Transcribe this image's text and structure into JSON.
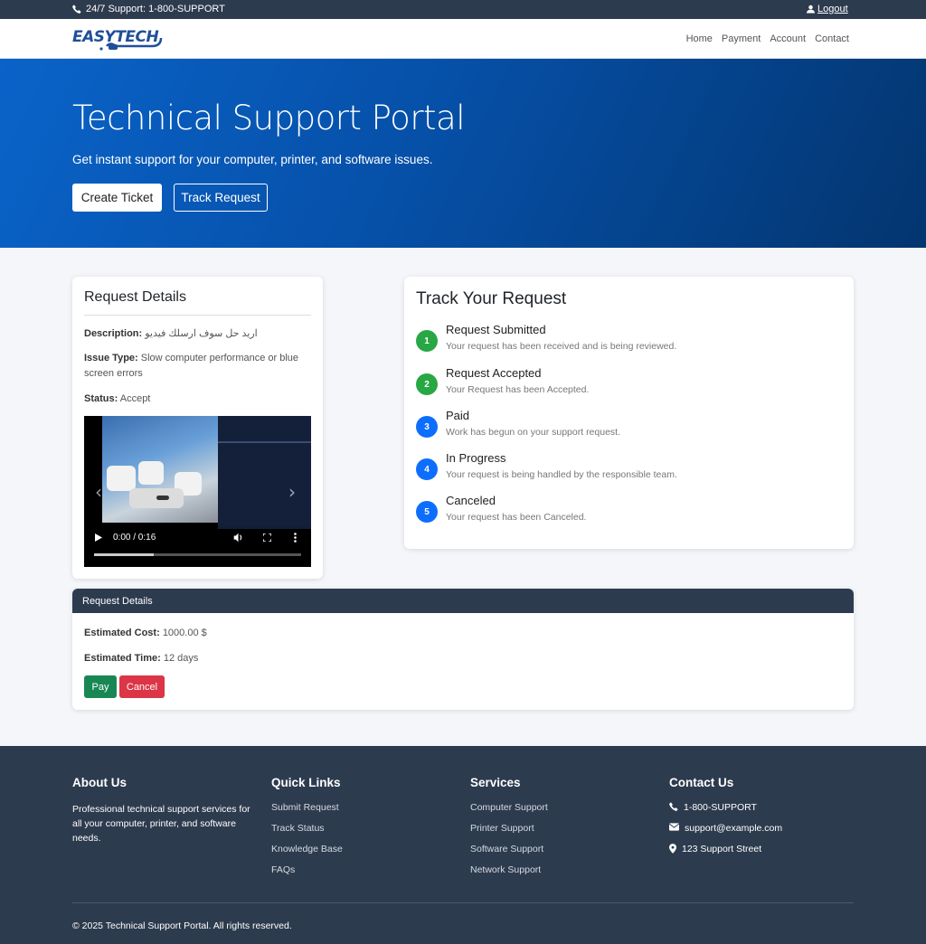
{
  "topbar": {
    "support": "24/7 Support: 1-800-SUPPORT",
    "logout": "Logout"
  },
  "brand": {
    "logo_text": "EASYTECH",
    "logo_color": "#1f4f9a"
  },
  "nav": [
    "Home",
    "Payment",
    "Account",
    "Contact"
  ],
  "hero": {
    "title": "Technical Support Portal",
    "subtitle": "Get instant support for your computer, printer, and software issues.",
    "create_ticket": "Create Ticket",
    "track_request": "Track Request"
  },
  "request": {
    "heading": "Request Details",
    "description_label": "Description:",
    "description": "اريد حل سوف ارسلك فيديو",
    "issue_label": "Issue Type:",
    "issue": "Slow computer performance or blue screen errors",
    "status_label": "Status:",
    "status": "Accept",
    "video_time": "0:00 / 0:16",
    "video_progress": 0.29
  },
  "track": {
    "heading": "Track Your Request",
    "steps": [
      {
        "num": "1",
        "title": "Request Submitted",
        "desc": "Your request has been received and is being reviewed.",
        "color": "#28a745"
      },
      {
        "num": "2",
        "title": "Request Accepted",
        "desc": "Your Request has been Accepted.",
        "color": "#28a745"
      },
      {
        "num": "3",
        "title": "Paid",
        "desc": "Work has begun on your support request.",
        "color": "#0d6efd"
      },
      {
        "num": "4",
        "title": "In Progress",
        "desc": "Your request is being handled by the responsible team.",
        "color": "#0d6efd"
      },
      {
        "num": "5",
        "title": "Canceled",
        "desc": "Your request has been Canceled.",
        "color": "#0d6efd"
      }
    ]
  },
  "estimate": {
    "heading": "Request Details",
    "cost_label": "Estimated Cost:",
    "cost": "1000.00 $",
    "time_label": "Estimated Time:",
    "time": "12 days",
    "pay": "Pay",
    "cancel": "Cancel"
  },
  "footer": {
    "about_title": "About Us",
    "about_text": "Professional technical support services for all your computer, printer, and software needs.",
    "quick_title": "Quick Links",
    "quick_links": [
      "Submit Request",
      "Track Status",
      "Knowledge Base",
      "FAQs"
    ],
    "services_title": "Services",
    "services": [
      "Computer Support",
      "Printer Support",
      "Software Support",
      "Network Support"
    ],
    "contact_title": "Contact Us",
    "phone": "1-800-SUPPORT",
    "email": "support@example.com",
    "address": "123 Support Street",
    "copyright": "© 2025 Technical Support Portal. All rights reserved."
  }
}
